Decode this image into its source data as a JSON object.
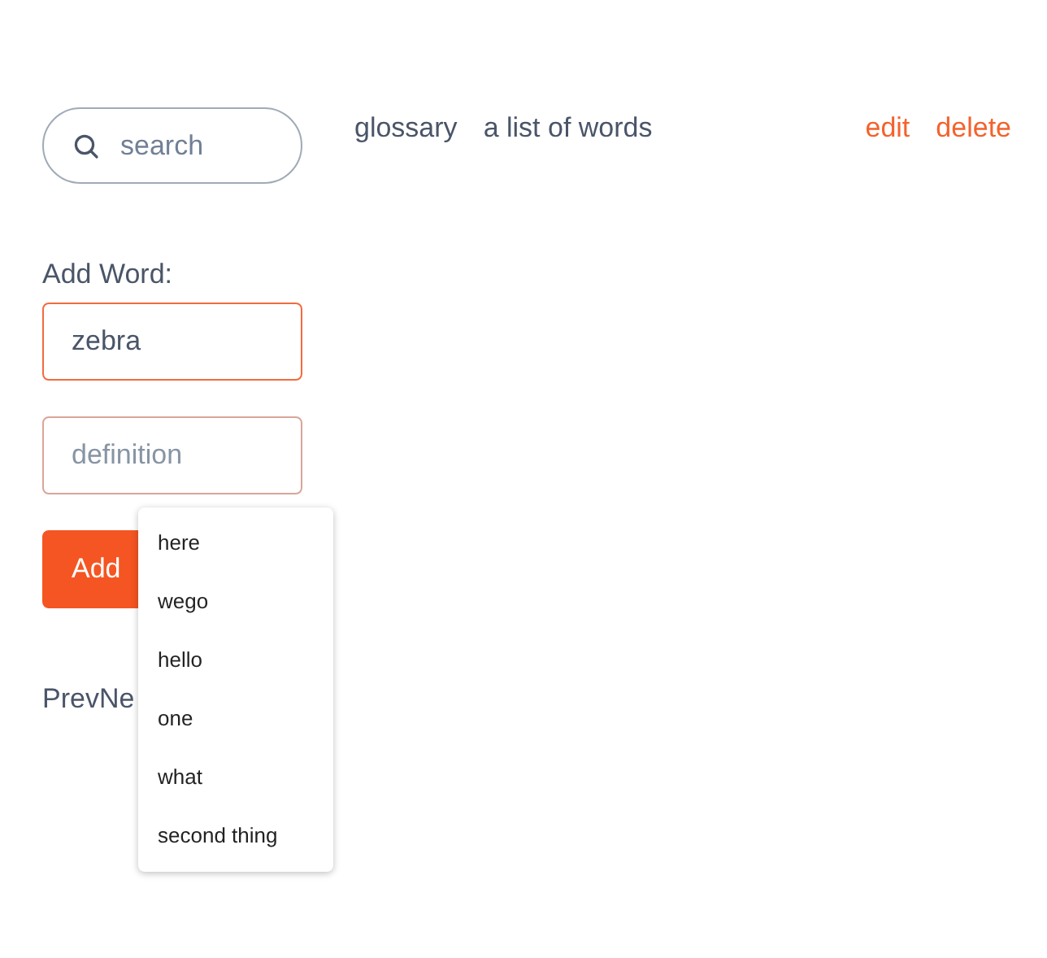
{
  "search": {
    "placeholder": "search"
  },
  "header": {
    "title": "glossary",
    "subtitle": "a list of words",
    "actions": [
      "edit",
      "delete"
    ]
  },
  "form": {
    "label": "Add Word:",
    "word_field": {
      "value": "zebra"
    },
    "definition_field": {
      "placeholder": "definition"
    },
    "submit_button": "Add"
  },
  "pagination": [
    "Prev",
    "Ne"
  ],
  "suggestions": [
    {
      "label": "here",
      "selected": false
    },
    {
      "label": "wego",
      "selected": false
    },
    {
      "label": "hello",
      "selected": false
    },
    {
      "label": "one",
      "selected": false
    },
    {
      "label": "what",
      "selected": false
    },
    {
      "label": "second thing",
      "selected": false
    }
  ]
}
